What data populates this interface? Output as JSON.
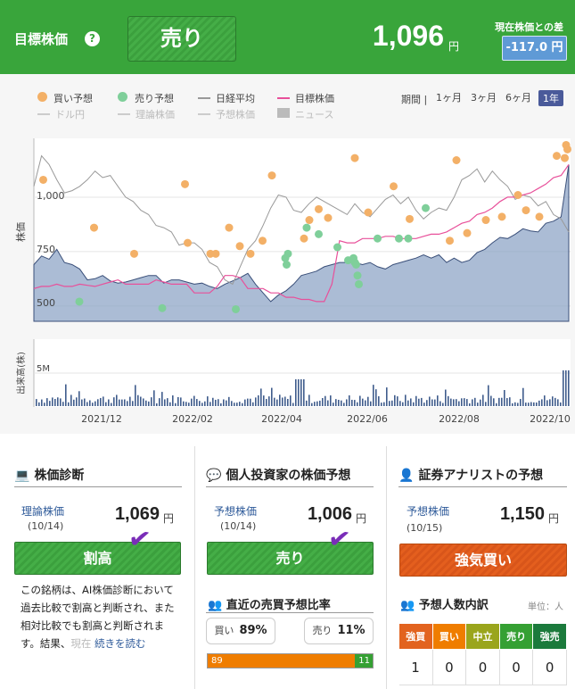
{
  "header": {
    "title": "目標株価",
    "help_icon": "?",
    "verdict": "売り",
    "price": "1,096",
    "price_unit": "円",
    "diff_label": "現在株価との差",
    "diff_value": "-117.0 円"
  },
  "legend": {
    "buy": "買い予想",
    "sell": "売り予想",
    "nikkei": "日経平均",
    "target": "目標株価",
    "usd": "ドル円",
    "theory": "理論株価",
    "forecast": "予想株価",
    "news": "ニュース"
  },
  "colors": {
    "brand_green": "#39a53b",
    "buy": "#f3b067",
    "sell": "#7fcf9a",
    "target": "#e8509a",
    "price_area": "#8fa6c7",
    "nikkei": "#999999"
  },
  "period": {
    "label": "期間",
    "options": [
      "1ヶ月",
      "3ヶ月",
      "6ヶ月",
      "1年"
    ],
    "selected": "1年"
  },
  "chart_data": {
    "type": "line",
    "ylabel": "株価",
    "yticks": [
      "1,000",
      "750",
      "500"
    ],
    "ylim": [
      450,
      1250
    ],
    "volume_label": "出来高(株)",
    "volume_tick": "5M",
    "xticks": [
      "2021/12",
      "2022/02",
      "2022/04",
      "2022/06",
      "2022/08",
      "2022/10"
    ],
    "series": [
      {
        "name": "株価",
        "values": [
          690,
          730,
          715,
          760,
          700,
          690,
          670,
          620,
          625,
          640,
          615,
          605,
          610,
          620,
          630,
          640,
          640,
          605,
          620,
          620,
          610,
          600,
          605,
          590,
          580,
          600,
          615,
          630,
          650,
          600,
          560,
          520,
          550,
          570,
          600,
          640,
          650,
          660,
          680,
          690,
          700,
          700,
          700,
          690,
          700,
          680,
          670,
          690,
          700,
          710,
          720,
          735,
          720,
          735,
          700,
          720,
          700,
          710,
          745,
          760,
          790,
          815,
          810,
          830,
          855,
          845,
          840,
          880,
          890,
          910,
          1150
        ]
      },
      {
        "name": "目標株価",
        "values": [
          580,
          590,
          590,
          600,
          590,
          590,
          600,
          595,
          590,
          600,
          610,
          620,
          600,
          600,
          600,
          600,
          620,
          610,
          600,
          600,
          600,
          560,
          560,
          560,
          590,
          640,
          640,
          630,
          580,
          580,
          580,
          560,
          560,
          540,
          540,
          530,
          530,
          520,
          520,
          600,
          800,
          790,
          790,
          810,
          810,
          810,
          820,
          820,
          810,
          810,
          810,
          820,
          830,
          830,
          840,
          860,
          880,
          890,
          920,
          930,
          950,
          980,
          1000,
          1000,
          1010,
          1020,
          1040,
          1060,
          1090,
          1100,
          1150
        ]
      },
      {
        "name": "日経平均",
        "values": [
          1050,
          1190,
          1150,
          1080,
          1020,
          1030,
          1050,
          1080,
          1120,
          1090,
          1100,
          1050,
          1000,
          980,
          940,
          920,
          870,
          860,
          840,
          780,
          790,
          790,
          760,
          700,
          680,
          620,
          600,
          680,
          760,
          800,
          870,
          950,
          1010,
          1000,
          940,
          930,
          970,
          1000,
          980,
          960,
          940,
          920,
          970,
          930,
          910,
          950,
          990,
          1010,
          970,
          1000,
          940,
          900,
          930,
          950,
          940,
          1000,
          1080,
          1100,
          1130,
          1070,
          1120,
          1080,
          1050,
          990,
          1010,
          1000,
          960,
          980,
          920,
          900,
          840
        ]
      },
      {
        "name": "買い予想",
        "points": [
          [
            0.7,
            1080
          ],
          [
            4.5,
            860
          ],
          [
            7.5,
            740
          ],
          [
            11.3,
            1060
          ],
          [
            11.5,
            790
          ],
          [
            13.2,
            740
          ],
          [
            13.6,
            740
          ],
          [
            14.6,
            860
          ],
          [
            15.4,
            775
          ],
          [
            16.2,
            740
          ],
          [
            17.1,
            800
          ],
          [
            17.8,
            1100
          ],
          [
            20.2,
            810
          ],
          [
            20.6,
            895
          ],
          [
            21.3,
            945
          ],
          [
            22.0,
            905
          ],
          [
            24.0,
            1180
          ],
          [
            25.0,
            930
          ],
          [
            26.9,
            1050
          ],
          [
            28.1,
            900
          ],
          [
            31.1,
            800
          ],
          [
            31.6,
            1170
          ],
          [
            32.4,
            835
          ],
          [
            33.8,
            895
          ],
          [
            35.0,
            910
          ],
          [
            36.2,
            1010
          ],
          [
            36.8,
            940
          ],
          [
            37.8,
            910
          ],
          [
            39.1,
            1190
          ],
          [
            39.7,
            1180
          ],
          [
            39.9,
            1220
          ],
          [
            39.8,
            1240
          ]
        ]
      },
      {
        "name": "売り予想",
        "points": [
          [
            3.4,
            520
          ],
          [
            9.6,
            490
          ],
          [
            15.1,
            485
          ],
          [
            18.8,
            720
          ],
          [
            18.9,
            690
          ],
          [
            19.0,
            740
          ],
          [
            20.4,
            860
          ],
          [
            21.3,
            830
          ],
          [
            22.7,
            770
          ],
          [
            23.5,
            710
          ],
          [
            23.9,
            720
          ],
          [
            24.0,
            700
          ],
          [
            24.1,
            690
          ],
          [
            24.2,
            640
          ],
          [
            24.3,
            600
          ],
          [
            25.7,
            810
          ],
          [
            27.3,
            810
          ],
          [
            28.0,
            810
          ],
          [
            29.3,
            950
          ]
        ]
      }
    ]
  },
  "diagnosis": {
    "title": "株価診断",
    "theory_label": "理論株価",
    "theory_date": "(10/14)",
    "theory_value": "1,069",
    "unit": "円",
    "verdict": "割高",
    "desc": "この銘柄は、AI株価診断において過去比較で割高と判断され、また相対比較でも割高と判断されます。結果、",
    "desc_fade": "現在",
    "read_more": "続きを読む"
  },
  "individual": {
    "title": "個人投資家の株価予想",
    "forecast_label": "予想株価",
    "forecast_date": "(10/14)",
    "forecast_value": "1,006",
    "unit": "円",
    "verdict": "売り",
    "ratio_title": "直近の売買予想比率",
    "buy_label": "買い",
    "buy_pct": "89%",
    "sell_label": "売り",
    "sell_pct": "11%",
    "buy_count": "89",
    "sell_count": "11",
    "buy_ratio": 0.89
  },
  "analyst": {
    "title": "証券アナリストの予想",
    "forecast_label": "予想株価",
    "forecast_date": "(10/15)",
    "forecast_value": "1,150",
    "unit": "円",
    "verdict": "強気買い",
    "count_title": "予想人数内訳",
    "count_unit": "単位：人",
    "headers": [
      "強買",
      "買い",
      "中立",
      "売り",
      "強売"
    ],
    "header_colors": [
      "#e2631f",
      "#ef7d00",
      "#9aa51c",
      "#35a033",
      "#1b7a3c"
    ],
    "counts": [
      "1",
      "0",
      "0",
      "0",
      "0"
    ]
  }
}
